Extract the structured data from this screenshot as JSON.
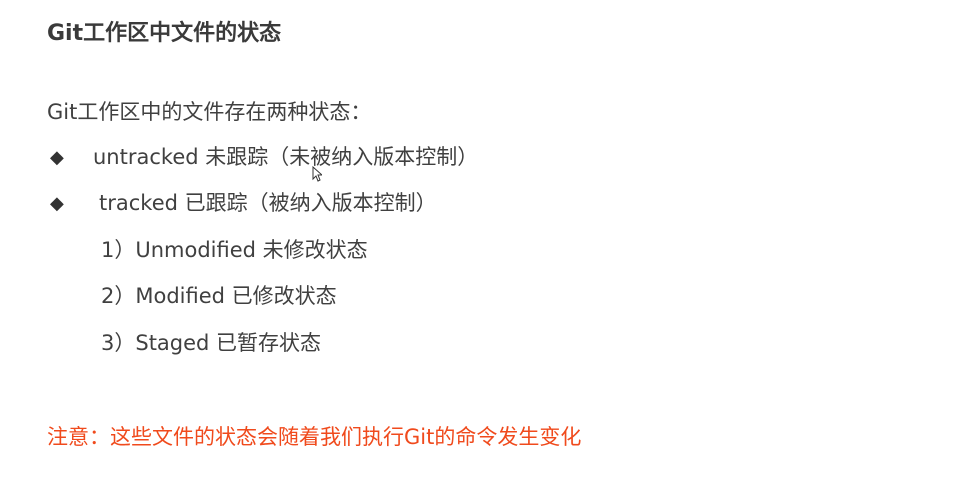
{
  "title": "Git工作区中文件的状态",
  "intro": "Git工作区中的文件存在两种状态：",
  "bullets": [
    {
      "symbol": "◆",
      "text": "untracked 未跟踪（未被纳入版本控制）"
    },
    {
      "symbol": "◆",
      "text": "tracked 已跟踪（被纳入版本控制）"
    }
  ],
  "tracked_states": [
    "1）Unmodified 未修改状态",
    "2）Modified 已修改状态",
    "3）Staged 已暂存状态"
  ],
  "note": "注意：这些文件的状态会随着我们执行Git的命令发生变化",
  "colors": {
    "text": "#404040",
    "note": "#f04a1c"
  }
}
